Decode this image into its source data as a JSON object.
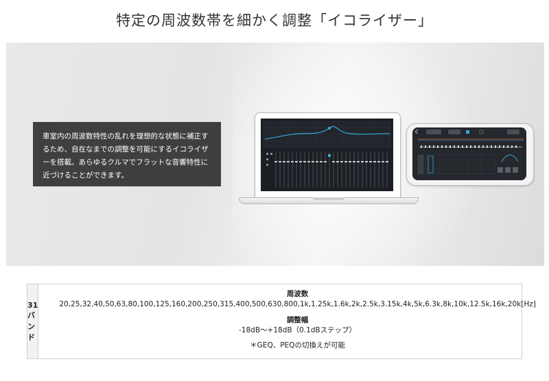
{
  "header": {
    "title": "特定の周波数帯を細かく調整「イコライザー」"
  },
  "hero": {
    "description": "車室内の周波数特性の乱れを理想的な状態に補正するため、自在なまでの調整を可能にするイコライザーを搭載。あらゆるクルマでフラットな音響特性に近づけることができます。",
    "accent_color": "#39a9d6"
  },
  "spec": {
    "label": "31バンド",
    "frequency_heading": "周波数",
    "frequency_values": "20,25,32,40,50,63,80,100,125,160,200,250,315,400,500,630,800,1k,1.25k,1.6k,2k,2.5k,3.15k,4k,5k,6.3k,8k,10k,12.5k,16k,20k[Hz]",
    "range_heading": "調整幅",
    "range_value": "-18dB～+18dB（0.1dBステップ）",
    "note": "＊GEQ、PEQの切換えが可能"
  }
}
